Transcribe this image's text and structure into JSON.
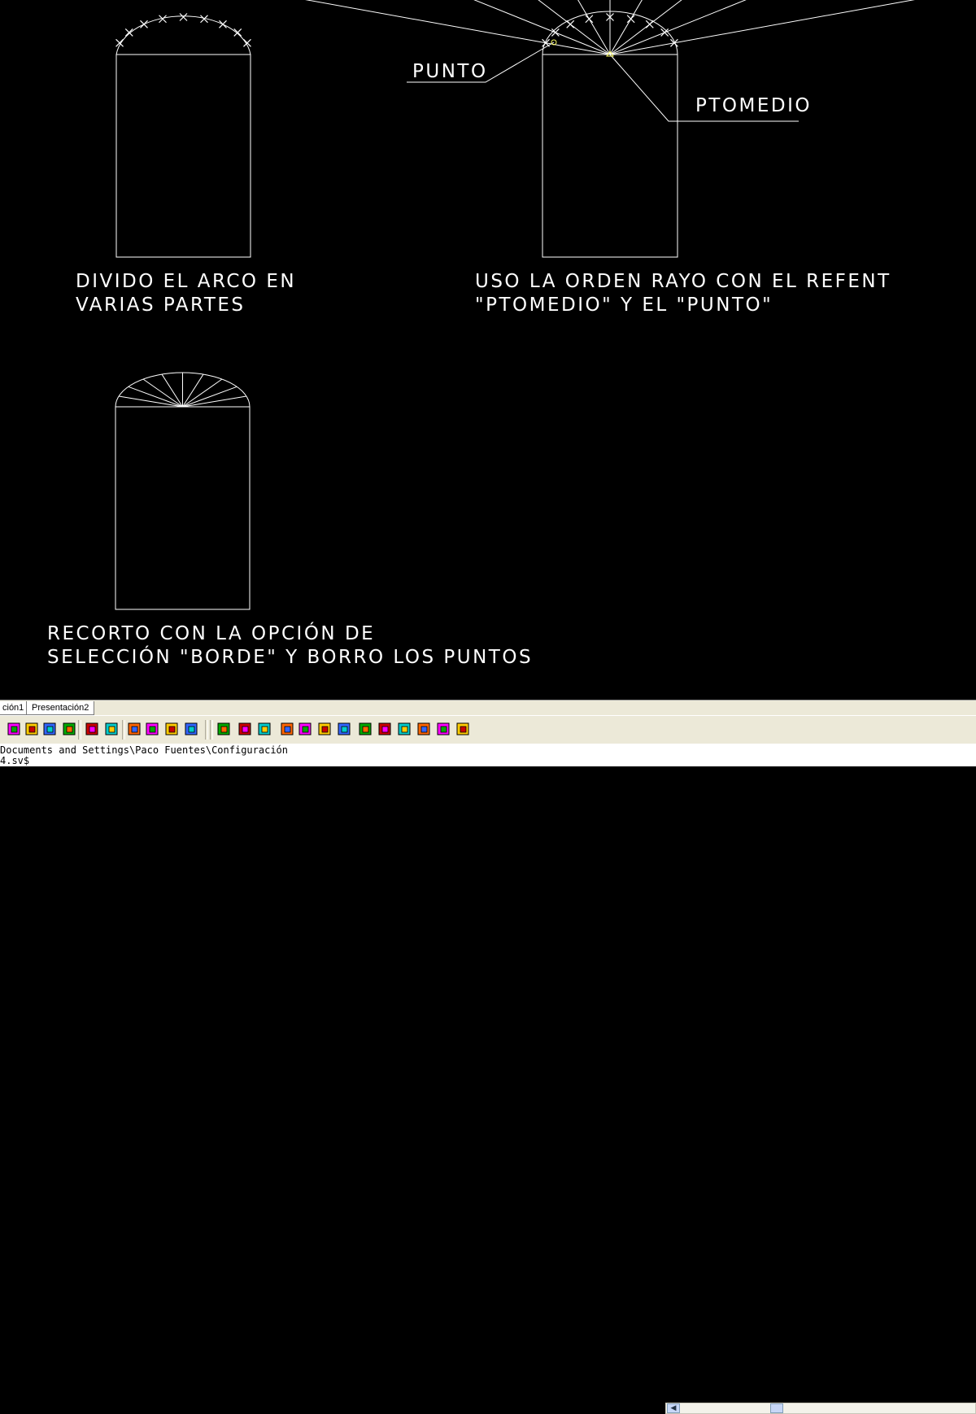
{
  "drawing": {
    "step1": {
      "caption_line1": "DIVIDO EL ARCO EN",
      "caption_line2": "VARIAS PARTES"
    },
    "step2": {
      "label_punto": "PUNTO",
      "label_ptomedio": "PTOMEDIO",
      "caption_line1": "USO LA ORDEN RAYO CON EL REFENT",
      "caption_line2": "\"PTOMEDIO\" Y EL \"PUNTO\""
    },
    "step3": {
      "caption_line1": "RECORTO CON LA OPCIÓN DE",
      "caption_line2": "SELECCIÓN \"BORDE\" Y BORRO LOS PUNTOS"
    },
    "colors": {
      "background": "#000000",
      "lines": "#ffffff",
      "osnap_marker": "#ffff66"
    }
  },
  "layout_tabs": {
    "tab1": "ción1",
    "tab2": "Presentación2"
  },
  "toolbar": {
    "icons": [
      "attribute-icon",
      "attribute-edit-icon",
      "attribute-define-icon",
      "attribute-block-icon",
      "layer-tool-icon",
      "layer-tool-icon",
      "layer-tool-icon",
      "layer-tool-icon",
      "layer-tool-icon",
      "layer-tool-icon",
      "layer-tool-icon",
      "layer-tool-icon",
      "layer-tool-icon",
      "layer-tool-icon",
      "layer-tool-icon",
      "layer-tool-icon",
      "layer-tool-icon",
      "layer-tool-icon",
      "layer-tool-icon",
      "layer-tool-icon",
      "layer-tool-icon",
      "layer-tool-icon",
      "layer-tool-icon"
    ]
  },
  "command_line": {
    "line1": "Documents and Settings\\Paco Fuentes\\Configuración",
    "line2": "4.sv$"
  }
}
